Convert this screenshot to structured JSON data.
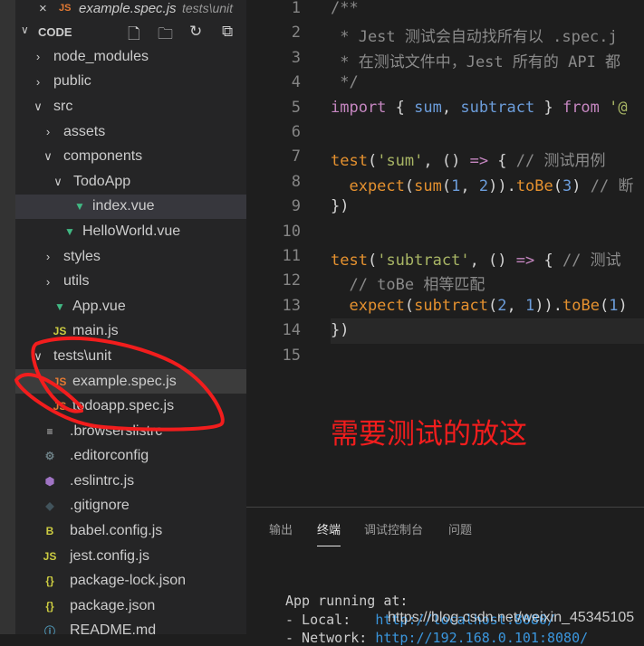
{
  "open_editor": {
    "close": "×",
    "icon": "JS",
    "name": "example.spec.js",
    "dir": "tests\\unit"
  },
  "explorer": {
    "title": "CODE",
    "chevron": "∨",
    "icons": [
      "new-file-icon",
      "new-folder-icon",
      "refresh-icon",
      "collapse-all-icon"
    ],
    "icon_glyphs": [
      "🗋",
      "🗀",
      "↻",
      "⧉"
    ]
  },
  "tree": [
    {
      "label": "node_modules",
      "type": "folder",
      "open": false,
      "level": 0
    },
    {
      "label": "public",
      "type": "folder",
      "open": false,
      "level": 0
    },
    {
      "label": "src",
      "type": "folder",
      "open": true,
      "level": 0
    },
    {
      "label": "assets",
      "type": "folder",
      "open": false,
      "level": 1
    },
    {
      "label": "components",
      "type": "folder",
      "open": true,
      "level": 1
    },
    {
      "label": "TodoApp",
      "type": "folder",
      "open": true,
      "level": 2
    },
    {
      "label": "index.vue",
      "type": "vue",
      "level": 3,
      "state": "selected"
    },
    {
      "label": "HelloWorld.vue",
      "type": "vue",
      "level": 2
    },
    {
      "label": "styles",
      "type": "folder",
      "open": false,
      "level": 1
    },
    {
      "label": "utils",
      "type": "folder",
      "open": false,
      "level": 1
    },
    {
      "label": "App.vue",
      "type": "vue",
      "level": 1
    },
    {
      "label": "main.js",
      "type": "js",
      "level": 1
    },
    {
      "label": "tests\\unit",
      "type": "folder",
      "open": true,
      "level": 0
    },
    {
      "label": "example.spec.js",
      "type": "jsorange",
      "level": 1,
      "state": "active"
    },
    {
      "label": "todoapp.spec.js",
      "type": "jsorange",
      "level": 1
    },
    {
      "label": ".browserslistrc",
      "type": "lines",
      "level": 0
    },
    {
      "label": ".editorconfig",
      "type": "gear",
      "level": 0
    },
    {
      "label": ".eslintrc.js",
      "type": "eslint",
      "level": 0
    },
    {
      "label": ".gitignore",
      "type": "git",
      "level": 0
    },
    {
      "label": "babel.config.js",
      "type": "babel",
      "level": 0
    },
    {
      "label": "jest.config.js",
      "type": "js",
      "level": 0
    },
    {
      "label": "package-lock.json",
      "type": "json",
      "level": 0
    },
    {
      "label": "package.json",
      "type": "json",
      "level": 0
    },
    {
      "label": "README.md",
      "type": "info",
      "level": 0
    }
  ],
  "code": [
    [
      [
        "/**",
        "c"
      ]
    ],
    [
      [
        " * Jest 测试会自动找所有以 .spec.j",
        "c"
      ]
    ],
    [
      [
        " * 在测试文件中，Jest 所有的 API 都",
        "c"
      ]
    ],
    [
      [
        " */",
        "c"
      ]
    ],
    [
      [
        "import",
        "k"
      ],
      [
        " { ",
        "p"
      ],
      [
        "sum",
        "v"
      ],
      [
        ", ",
        "p"
      ],
      [
        "subtract",
        "v"
      ],
      [
        " } ",
        "p"
      ],
      [
        "from",
        "k"
      ],
      [
        " '@",
        "s"
      ]
    ],
    [],
    [
      [
        "test",
        "f"
      ],
      [
        "(",
        "p"
      ],
      [
        "'sum'",
        "s"
      ],
      [
        ", () ",
        "p"
      ],
      [
        "=>",
        "k"
      ],
      [
        " { ",
        "p"
      ],
      [
        "// 测试用例",
        "c"
      ]
    ],
    [
      [
        "  expect",
        "f"
      ],
      [
        "(",
        "p"
      ],
      [
        "sum",
        "f"
      ],
      [
        "(",
        "p"
      ],
      [
        "1",
        "n"
      ],
      [
        ", ",
        "p"
      ],
      [
        "2",
        "n"
      ],
      [
        ")).",
        "p"
      ],
      [
        "toBe",
        "f"
      ],
      [
        "(",
        "p"
      ],
      [
        "3",
        "n"
      ],
      [
        ") ",
        "p"
      ],
      [
        "// 断",
        "c"
      ]
    ],
    [
      [
        "})",
        "p"
      ]
    ],
    [],
    [
      [
        "test",
        "f"
      ],
      [
        "(",
        "p"
      ],
      [
        "'subtract'",
        "s"
      ],
      [
        ", () ",
        "p"
      ],
      [
        "=>",
        "k"
      ],
      [
        " { ",
        "p"
      ],
      [
        "// 测试",
        "c"
      ]
    ],
    [
      [
        "  // toBe 相等匹配",
        "c"
      ]
    ],
    [
      [
        "  expect",
        "f"
      ],
      [
        "(",
        "p"
      ],
      [
        "subtract",
        "f"
      ],
      [
        "(",
        "p"
      ],
      [
        "2",
        "n"
      ],
      [
        ", ",
        "p"
      ],
      [
        "1",
        "n"
      ],
      [
        ")).",
        "p"
      ],
      [
        "toBe",
        "f"
      ],
      [
        "(",
        "p"
      ],
      [
        "1",
        "n"
      ],
      [
        ")",
        "p"
      ]
    ],
    [
      [
        "})",
        "p"
      ]
    ],
    []
  ],
  "current_line": 14,
  "annotation": "需要测试的放这",
  "panel": {
    "tabs": [
      "输出",
      "终端",
      "调试控制台",
      "问题"
    ],
    "active_tab": "终端",
    "terminal": {
      "line1": "App running at:",
      "local_label": "- Local:   ",
      "local_url": "http://localhost:8080/",
      "network_label": "- Network: ",
      "network_url": "http://192.168.0.101:8080/"
    }
  },
  "watermark": "https://blog.csdn.net/weixin_45345105",
  "colors": {
    "annotation": "#f21d1d",
    "sidebar": "#252526",
    "editor": "#1e1e1e"
  }
}
